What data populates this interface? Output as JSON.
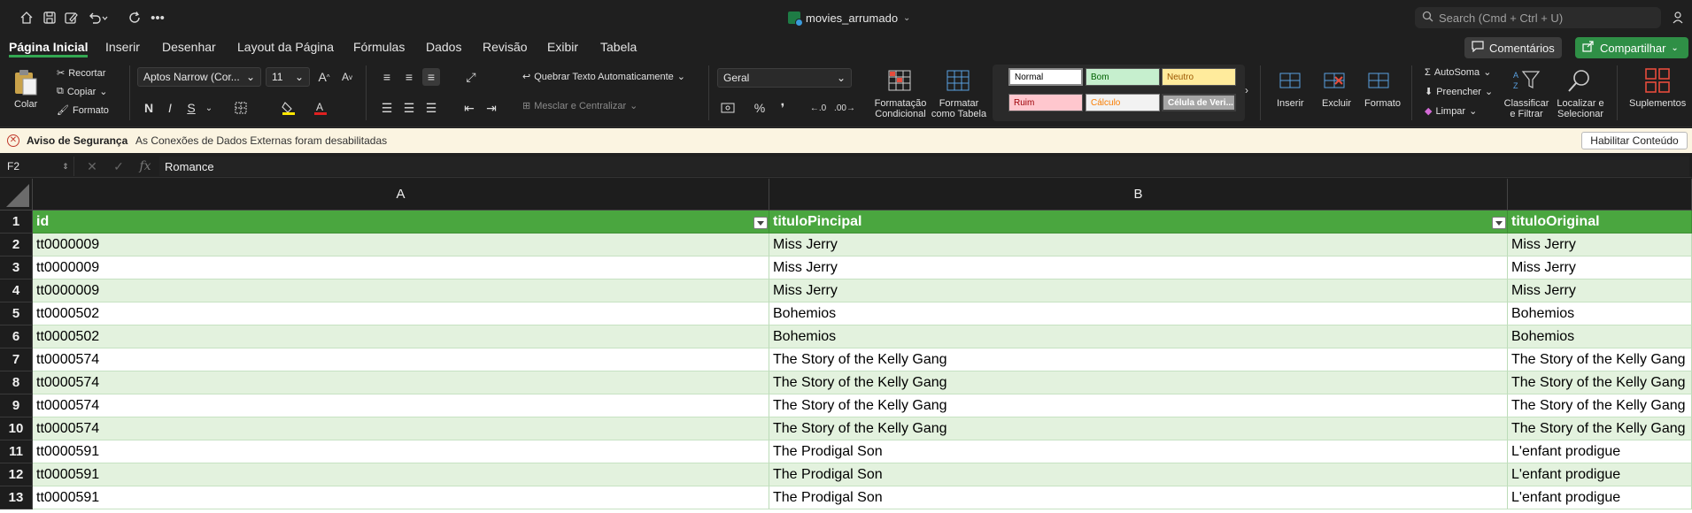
{
  "titlebar": {
    "document_title": "movies_arrumado",
    "search_placeholder": "Search (Cmd + Ctrl + U)",
    "icons": [
      "home-icon",
      "save-icon",
      "edit-icon",
      "undo-icon",
      "redo-icon",
      "more-icon"
    ]
  },
  "tabs": [
    "Página Inicial",
    "Inserir",
    "Desenhar",
    "Layout da Página",
    "Fórmulas",
    "Dados",
    "Revisão",
    "Exibir",
    "Tabela"
  ],
  "actions": {
    "comments": "Comentários",
    "share": "Compartilhar"
  },
  "ribbon": {
    "paste": "Colar",
    "cut": "Recortar",
    "copy": "Copiar",
    "format_painter": "Formato",
    "font_name": "Aptos Narrow (Cor...",
    "font_size": "11",
    "bold": "N",
    "italic": "I",
    "underline": "S",
    "wrap_text": "Quebrar Texto Automaticamente",
    "merge_center": "Mesclar e Centralizar",
    "number_format": "Geral",
    "percent": "%",
    "comma": "❜",
    "conditional_format": "Formatação\nCondicional",
    "format_as_table": "Formatar\ncomo Tabela",
    "styles": {
      "normal": "Normal",
      "good": "Bom",
      "neutral": "Neutro",
      "bad": "Ruim",
      "calc": "Cálculo",
      "check_cell": "Célula de Veri..."
    },
    "insert": "Inserir",
    "delete": "Excluir",
    "format": "Formato",
    "autosum": "AutoSoma",
    "fill": "Preencher",
    "clear": "Limpar",
    "sort_filter": "Classificar\ne Filtrar",
    "find_select": "Localizar e\nSelecionar",
    "addins": "Suplementos"
  },
  "security": {
    "title": "Aviso de Segurança",
    "message": "As Conexões de Dados Externas foram desabilitadas",
    "button": "Habilitar Conteúdo"
  },
  "formula_bar": {
    "cell_ref": "F2",
    "fx": "fx",
    "value": "Romance"
  },
  "sheet": {
    "columns": [
      "A",
      "B"
    ],
    "headers": [
      "id",
      "tituloPincipal",
      "tituloOriginal"
    ],
    "rows": [
      {
        "n": "2",
        "cells": [
          "tt0000009",
          "Miss Jerry",
          "Miss Jerry"
        ]
      },
      {
        "n": "3",
        "cells": [
          "tt0000009",
          "Miss Jerry",
          "Miss Jerry"
        ]
      },
      {
        "n": "4",
        "cells": [
          "tt0000009",
          "Miss Jerry",
          "Miss Jerry"
        ]
      },
      {
        "n": "5",
        "cells": [
          "tt0000502",
          "Bohemios",
          "Bohemios"
        ]
      },
      {
        "n": "6",
        "cells": [
          "tt0000502",
          "Bohemios",
          "Bohemios"
        ]
      },
      {
        "n": "7",
        "cells": [
          "tt0000574",
          "The Story of the Kelly Gang",
          "The Story of the Kelly Gang"
        ]
      },
      {
        "n": "8",
        "cells": [
          "tt0000574",
          "The Story of the Kelly Gang",
          "The Story of the Kelly Gang"
        ]
      },
      {
        "n": "9",
        "cells": [
          "tt0000574",
          "The Story of the Kelly Gang",
          "The Story of the Kelly Gang"
        ]
      },
      {
        "n": "10",
        "cells": [
          "tt0000574",
          "The Story of the Kelly Gang",
          "The Story of the Kelly Gang"
        ]
      },
      {
        "n": "11",
        "cells": [
          "tt0000591",
          "The Prodigal Son",
          "L'enfant prodigue"
        ]
      },
      {
        "n": "12",
        "cells": [
          "tt0000591",
          "The Prodigal Son",
          "L'enfant prodigue"
        ]
      },
      {
        "n": "13",
        "cells": [
          "tt0000591",
          "The Prodigal Son",
          "L'enfant prodigue"
        ]
      }
    ],
    "colors": {
      "header": "#4aa63f",
      "band": "#e3f2de",
      "accent": "#33a852"
    }
  }
}
